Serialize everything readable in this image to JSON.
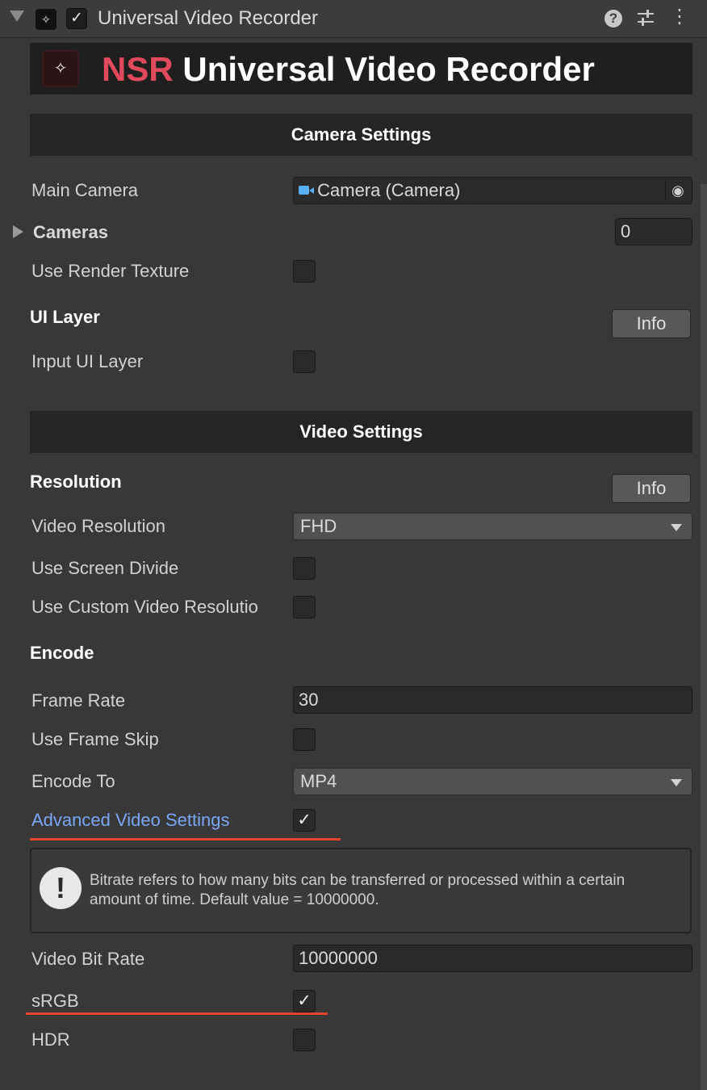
{
  "header": {
    "title": "Universal Video Recorder",
    "enabled": true
  },
  "banner": {
    "accent": "NSR",
    "title": "Universal Video Recorder",
    "accent_color": "#e04a5c"
  },
  "camera_settings": {
    "section_title": "Camera Settings",
    "main_camera_label": "Main Camera",
    "main_camera_value": "Camera (Camera)",
    "cameras_label": "Cameras",
    "cameras_count": "0",
    "use_render_texture_label": "Use Render Texture",
    "use_render_texture": false,
    "ui_layer_heading": "UI Layer",
    "info_label": "Info",
    "input_ui_layer_label": "Input UI Layer",
    "input_ui_layer": false
  },
  "video_settings": {
    "section_title": "Video Settings",
    "resolution_heading": "Resolution",
    "info_label": "Info",
    "video_resolution_label": "Video Resolution",
    "video_resolution_value": "FHD",
    "use_screen_divide_label": "Use Screen Divide",
    "use_screen_divide": false,
    "use_custom_resolution_label": "Use Custom Video Resolutio",
    "use_custom_resolution": false,
    "encode_heading": "Encode",
    "frame_rate_label": "Frame Rate",
    "frame_rate_value": "30",
    "use_frame_skip_label": "Use Frame Skip",
    "use_frame_skip": false,
    "encode_to_label": "Encode To",
    "encode_to_value": "MP4",
    "advanced_label": "Advanced Video Settings",
    "advanced": true,
    "help_text": "Bitrate refers to how many bits can be transferred or processed within a certain amount of time. Default value = 10000000.",
    "bit_rate_label": "Video Bit Rate",
    "bit_rate_value": "10000000",
    "srgb_label": "sRGB",
    "srgb": true,
    "hdr_label": "HDR",
    "hdr": false
  },
  "colors": {
    "highlight_line": "#e0442e",
    "link_text": "#7aa7f5",
    "camera_icon": "#5aaef2"
  }
}
